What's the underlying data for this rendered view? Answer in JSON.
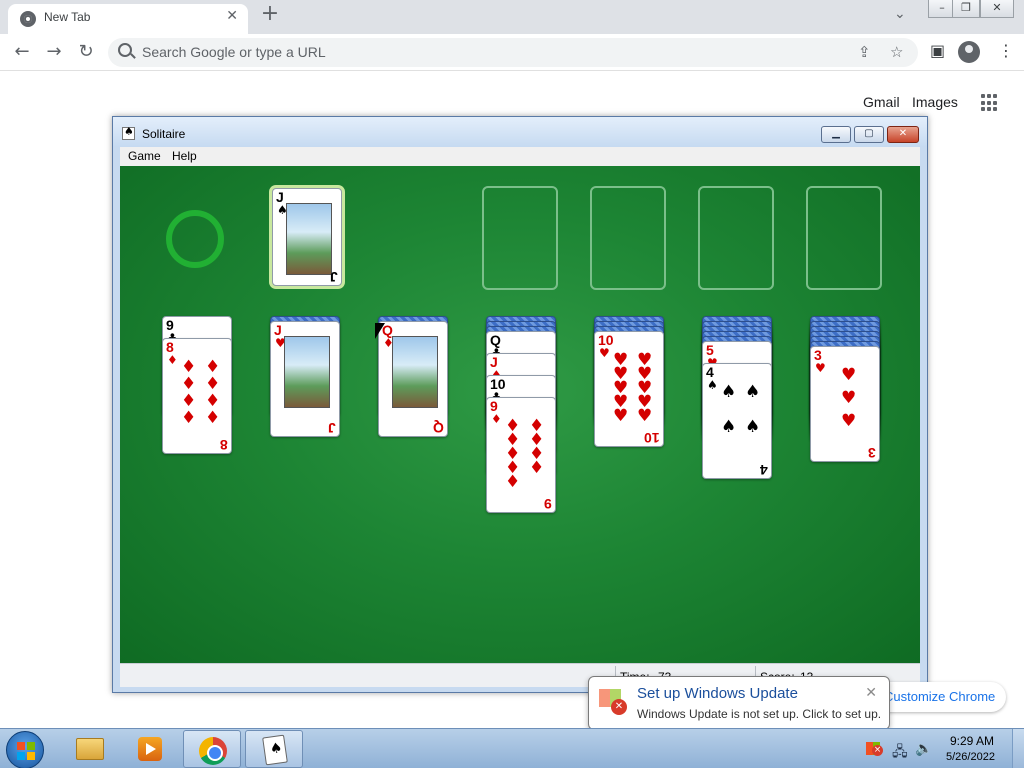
{
  "browser": {
    "tab_title": "New Tab",
    "omnibox_placeholder": "Search Google or type a URL",
    "ntp_links": {
      "gmail": "Gmail",
      "images": "Images"
    },
    "customize_label": "Customize Chrome"
  },
  "solitaire": {
    "title": "Solitaire",
    "menu": {
      "game": "Game",
      "help": "Help"
    },
    "status": {
      "time_label": "Time:",
      "time_value": "73",
      "score_label": "Score:",
      "score_value": "13"
    },
    "waste_card": {
      "rank": "J",
      "suit": "♠"
    },
    "tableau": [
      {
        "hidden": 0,
        "cards": [
          {
            "rank": "9",
            "suit": "♣"
          },
          {
            "rank": "8",
            "suit": "♦"
          }
        ]
      },
      {
        "hidden": 1,
        "cards": [
          {
            "rank": "J",
            "suit": "♥"
          }
        ]
      },
      {
        "hidden": 1,
        "cards": [
          {
            "rank": "Q",
            "suit": "♦"
          }
        ]
      },
      {
        "hidden": 3,
        "cards": [
          {
            "rank": "Q",
            "suit": "♣"
          },
          {
            "rank": "J",
            "suit": "♦"
          },
          {
            "rank": "10",
            "suit": "♣"
          },
          {
            "rank": "9",
            "suit": "♦"
          }
        ]
      },
      {
        "hidden": 3,
        "cards": [
          {
            "rank": "10",
            "suit": "♥"
          }
        ]
      },
      {
        "hidden": 5,
        "cards": [
          {
            "rank": "5",
            "suit": "♥"
          },
          {
            "rank": "4",
            "suit": "♠"
          }
        ]
      },
      {
        "hidden": 6,
        "cards": [
          {
            "rank": "3",
            "suit": "♥"
          }
        ]
      }
    ]
  },
  "notification": {
    "title": "Set up Windows Update",
    "message": "Windows Update is not set up. Click to set up."
  },
  "taskbar": {
    "time": "9:29 AM",
    "date": "5/26/2022"
  },
  "colors": {
    "felt": "#1d8534",
    "card_red": "#d40000",
    "card_back": "#3d6ec7",
    "link_blue": "#1a73e8"
  }
}
